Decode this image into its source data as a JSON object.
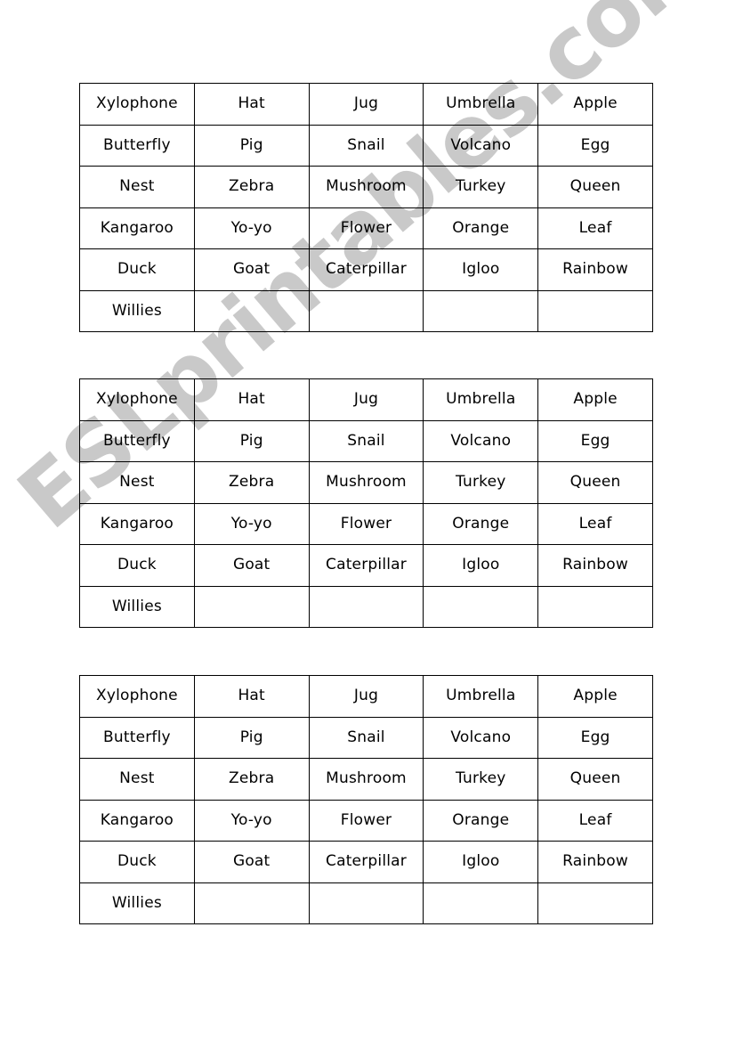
{
  "document": {
    "page_background": "#ffffff",
    "border_color": "#000000",
    "text_color": "#000000"
  },
  "watermark": {
    "text": "ESLprintables.com",
    "color": "#c9c9c9",
    "outline_color": "#ffffff",
    "rotation_deg": -40.5
  },
  "tables": [
    {
      "id": "table-1",
      "rows": [
        [
          "Xylophone",
          "Hat",
          "Jug",
          "Umbrella",
          "Apple"
        ],
        [
          "Butterfly",
          "Pig",
          "Snail",
          "Volcano",
          "Egg"
        ],
        [
          "Nest",
          "Zebra",
          "Mushroom",
          "Turkey",
          "Queen"
        ],
        [
          "Kangaroo",
          "Yo-yo",
          "Flower",
          "Orange",
          "Leaf"
        ],
        [
          "Duck",
          "Goat",
          "Caterpillar",
          "Igloo",
          "Rainbow"
        ],
        [
          "Willies",
          "",
          "",
          "",
          ""
        ]
      ]
    },
    {
      "id": "table-2",
      "rows": [
        [
          "Xylophone",
          "Hat",
          "Jug",
          "Umbrella",
          "Apple"
        ],
        [
          "Butterfly",
          "Pig",
          "Snail",
          "Volcano",
          "Egg"
        ],
        [
          "Nest",
          "Zebra",
          "Mushroom",
          "Turkey",
          "Queen"
        ],
        [
          "Kangaroo",
          "Yo-yo",
          "Flower",
          "Orange",
          "Leaf"
        ],
        [
          "Duck",
          "Goat",
          "Caterpillar",
          "Igloo",
          "Rainbow"
        ],
        [
          "Willies",
          "",
          "",
          "",
          ""
        ]
      ]
    },
    {
      "id": "table-3",
      "rows": [
        [
          "Xylophone",
          "Hat",
          "Jug",
          "Umbrella",
          "Apple"
        ],
        [
          "Butterfly",
          "Pig",
          "Snail",
          "Volcano",
          "Egg"
        ],
        [
          "Nest",
          "Zebra",
          "Mushroom",
          "Turkey",
          "Queen"
        ],
        [
          "Kangaroo",
          "Yo-yo",
          "Flower",
          "Orange",
          "Leaf"
        ],
        [
          "Duck",
          "Goat",
          "Caterpillar",
          "Igloo",
          "Rainbow"
        ],
        [
          "Willies",
          "",
          "",
          "",
          ""
        ]
      ]
    }
  ]
}
